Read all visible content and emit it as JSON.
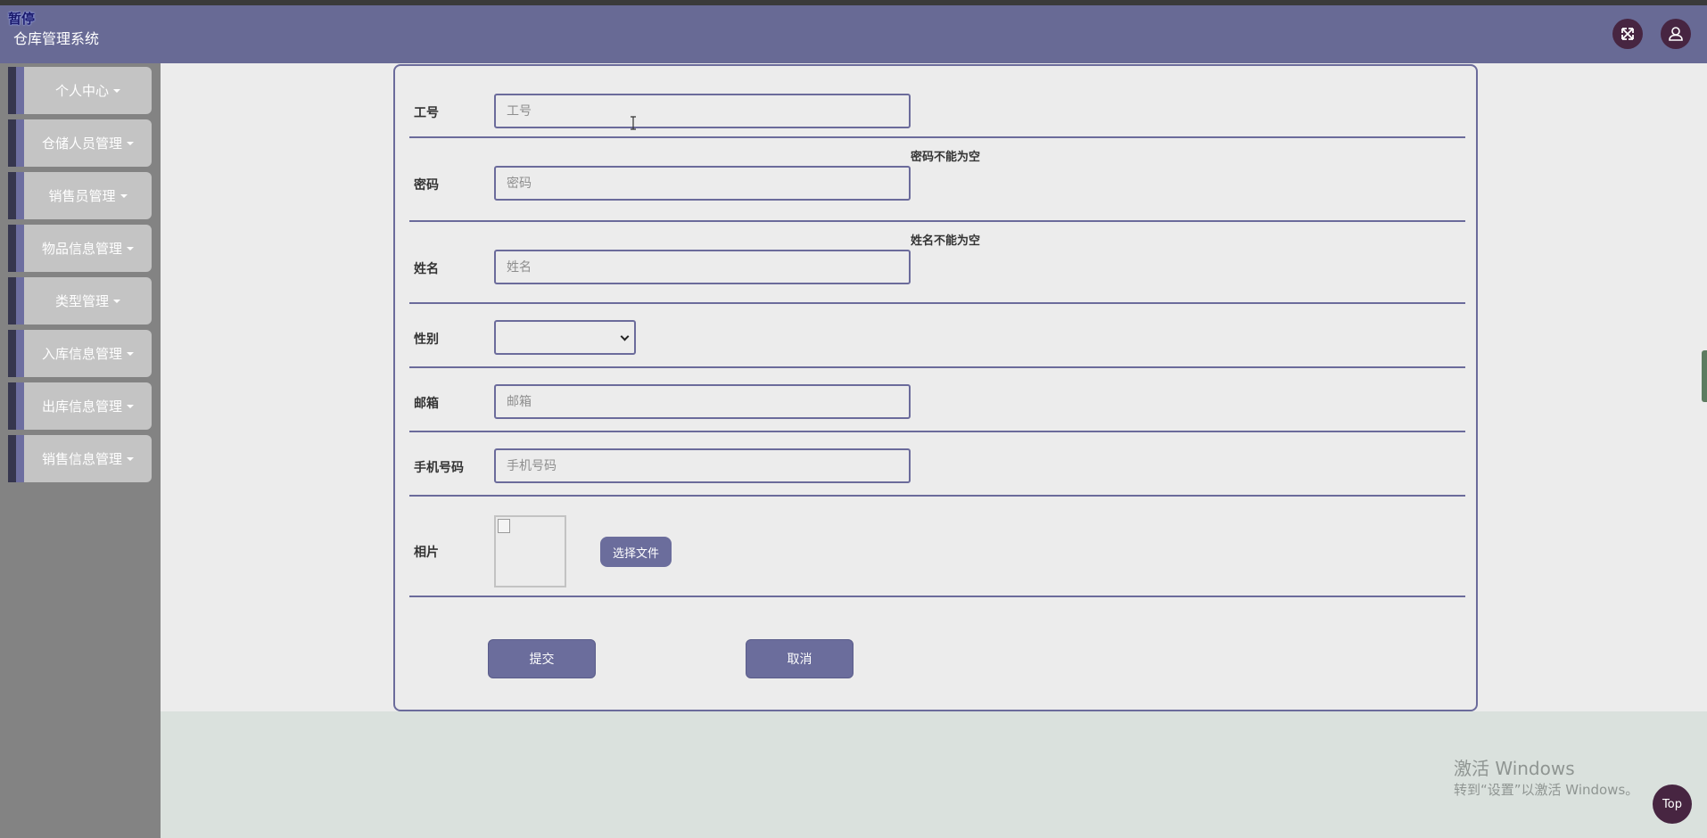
{
  "header": {
    "pause_label": "暂停",
    "app_title": "仓库管理系统",
    "fullscreen_icon": "fullscreen-icon",
    "user_icon": "user-icon",
    "accent_color": "#686a95"
  },
  "sidebar": {
    "items": [
      {
        "label": "个人中心"
      },
      {
        "label": "仓储人员管理"
      },
      {
        "label": "销售员管理"
      },
      {
        "label": "物品信息管理"
      },
      {
        "label": "类型管理"
      },
      {
        "label": "入库信息管理"
      },
      {
        "label": "出库信息管理"
      },
      {
        "label": "销售信息管理"
      }
    ]
  },
  "form": {
    "employee_id": {
      "label": "工号",
      "placeholder": "工号",
      "value": ""
    },
    "password": {
      "label": "密码",
      "placeholder": "密码",
      "value": "",
      "error": "密码不能为空"
    },
    "name": {
      "label": "姓名",
      "placeholder": "姓名",
      "value": "",
      "error": "姓名不能为空"
    },
    "gender": {
      "label": "性别",
      "value": ""
    },
    "email": {
      "label": "邮箱",
      "placeholder": "邮箱",
      "value": ""
    },
    "phone": {
      "label": "手机号码",
      "placeholder": "手机号码",
      "value": ""
    },
    "photo": {
      "label": "相片",
      "choose_file_label": "选择文件"
    },
    "submit_label": "提交",
    "cancel_label": "取消"
  },
  "watermark": {
    "line1": "激活 Windows",
    "line2": "转到“设置”以激活 Windows。"
  },
  "top_button_label": "Top"
}
